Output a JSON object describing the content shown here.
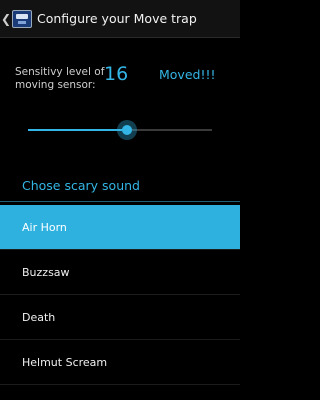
{
  "action_bar": {
    "title": "Configure your Move trap",
    "up_icon": "chevron-left-icon",
    "app_icon": "app-logo-icon"
  },
  "sensitivity": {
    "label": "Sensitivy level of moving sensor:",
    "value": "16",
    "status": "Moved!!!",
    "slider_fraction": 0.54
  },
  "sound_section": {
    "header": "Chose scary sound",
    "items": [
      {
        "label": "Air Horn",
        "selected": true
      },
      {
        "label": "Buzzsaw",
        "selected": false
      },
      {
        "label": "Death",
        "selected": false
      },
      {
        "label": "Helmut Scream",
        "selected": false
      }
    ]
  },
  "colors": {
    "accent": "#33b5e5",
    "background": "#000000",
    "selected_row": "#2fb1e0"
  }
}
